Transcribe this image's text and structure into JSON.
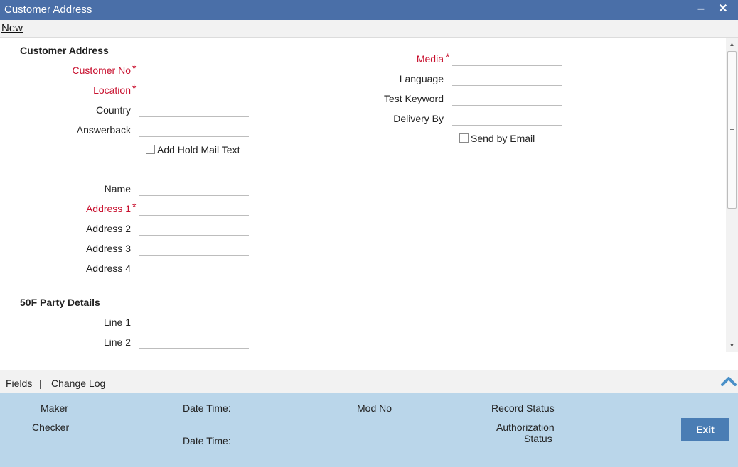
{
  "window": {
    "title": "Customer Address",
    "minimize_label": "‒",
    "close_label": "✕"
  },
  "toolbar": {
    "new_label": "New"
  },
  "customer_address": {
    "section_title": "Customer Address",
    "customer_no_label": "Customer No",
    "location_label": "Location",
    "country_label": "Country",
    "answerback_label": "Answerback",
    "add_hold_mail_label": "Add Hold Mail Text",
    "name_label": "Name",
    "address1_label": "Address 1",
    "address2_label": "Address 2",
    "address3_label": "Address 3",
    "address4_label": "Address 4",
    "media_label": "Media",
    "language_label": "Language",
    "test_keyword_label": "Test Keyword",
    "delivery_by_label": "Delivery By",
    "send_by_email_label": "Send by Email",
    "required_marker": "*"
  },
  "party_details": {
    "section_title": "50F Party Details",
    "line1_label": "Line 1",
    "line2_label": "Line 2"
  },
  "tabs": {
    "fields_label": "Fields",
    "separator": "|",
    "change_log_label": "Change Log"
  },
  "footer": {
    "maker_label": "Maker",
    "date_time_label": "Date Time:",
    "mod_no_label": "Mod No",
    "record_status_label": "Record Status",
    "checker_label": "Checker",
    "checker_date_time_label": "Date Time:",
    "authorization_label": "Authorization",
    "status_label": "Status",
    "exit_label": "Exit"
  },
  "colors": {
    "title_bar": "#4a6fa8",
    "required": "#c8102e",
    "footer_bg": "#bad6ea",
    "exit_button": "#4a7db4"
  }
}
